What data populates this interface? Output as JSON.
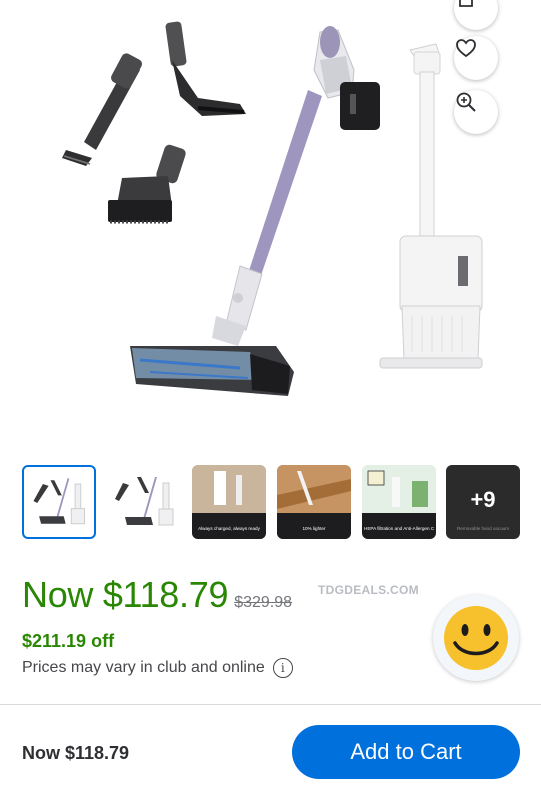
{
  "product": {
    "image_alt": "cordless stick vacuum with accessories and charging dock"
  },
  "actions": {
    "share_icon": "share-icon",
    "favorite_icon": "heart-icon",
    "zoom_icon": "zoom-in-icon"
  },
  "thumbnails": [
    {
      "caption": "",
      "selected": true
    },
    {
      "caption": "",
      "selected": false
    },
    {
      "caption": "Always charged, always ready",
      "selected": false
    },
    {
      "caption": "10% lighter",
      "selected": false
    },
    {
      "caption": "HEPA filtration and Anti-Allergen Complete Seal",
      "selected": false
    },
    {
      "caption": "Removable hand vacuum",
      "more_label": "+9",
      "selected": false
    }
  ],
  "pricing": {
    "now_price": "Now $118.79",
    "was_price": "$329.98",
    "savings": "$211.19 off",
    "note": "Prices may vary in club and online",
    "info_icon": "info-icon"
  },
  "watermark": "TDGDEALS.COM",
  "bottom_bar": {
    "price": "Now $118.79",
    "add_to_cart": "Add to Cart"
  },
  "colors": {
    "price_green": "#2a8703",
    "primary_blue": "#0071dc"
  }
}
